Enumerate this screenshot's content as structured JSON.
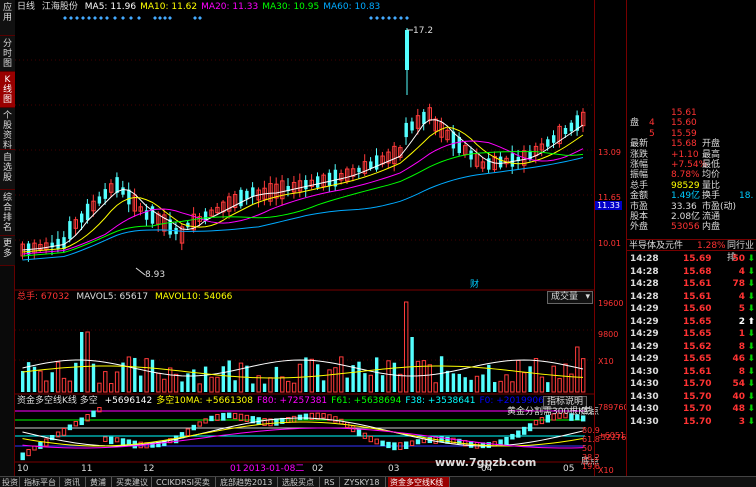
{
  "header": {
    "period": "日线",
    "stock_name": "江海股份",
    "ma": [
      {
        "label": "MA5: 11.96",
        "color": "#ffffff"
      },
      {
        "label": "MA10: 11.62",
        "color": "#ffff00"
      },
      {
        "label": "MA20: 11.33",
        "color": "#ff00ff"
      },
      {
        "label": "MA30: 10.95",
        "color": "#00ff00"
      },
      {
        "label": "MA60: 10.83",
        "color": "#00aaff"
      }
    ]
  },
  "left_tabs": [
    {
      "label": "应用",
      "active": false
    },
    {
      "label": "分时图",
      "active": false
    },
    {
      "label": "K线图",
      "active": true
    },
    {
      "label": "个股资料",
      "active": false
    },
    {
      "label": "自选股",
      "active": false
    },
    {
      "label": "综合排名",
      "active": false
    },
    {
      "label": "更多",
      "active": false
    }
  ],
  "price_panel": {
    "axis_labels": [
      "13.09",
      "11.65",
      "11.33",
      "10.01"
    ],
    "high_label": "17.2",
    "low_label": "8.93",
    "marker": "财",
    "price_tag": "11.33"
  },
  "volume_panel": {
    "total_label": "总手: 67032",
    "vol5_label": "MAVOL5: 65617",
    "vol10_label": "MAVOL10: 54066",
    "dropdown": "成交量",
    "axis_labels": [
      "19600",
      "9800",
      "X10"
    ]
  },
  "indicator_panel": {
    "title": "资金多空线K线 多空",
    "values": [
      {
        "label": "+5696142",
        "color": "#ffffff"
      },
      {
        "label": "多空10MA: +5661308",
        "color": "#ffff00"
      },
      {
        "label": "F80: +7257381",
        "color": "#ff00ff"
      },
      {
        "label": "F61: +5638694",
        "color": "#00ff00"
      },
      {
        "label": "F38: +3538641",
        "color": "#00ffff"
      },
      {
        "label": "F0: +2019906",
        "color": "#0000ff"
      }
    ],
    "indicator_button": "指标说明",
    "note": "黄金分割需300根K线",
    "note2": "底点",
    "note3": "底点",
    "axis_labels": [
      "7897607",
      "+605113",
      "-3227620",
      "X10"
    ],
    "right_labels": [
      "80.9",
      "61.8",
      "50",
      "38.2",
      "19.6"
    ]
  },
  "date_axis": [
    "10",
    "11",
    "12",
    "01",
    "2013-01-08二",
    "02",
    "03",
    "04",
    "05"
  ],
  "quote": {
    "top_rows": [
      {
        "l": "",
        "v": "15.61",
        "v2": "",
        "c": "#f33"
      },
      {
        "l": "盘",
        "v": "4",
        "v2": "15.60",
        "c": "#f33"
      },
      {
        "l": "",
        "v": "5",
        "v2": "15.59",
        "c": "#f33"
      },
      {
        "l": "最新",
        "v": "15.68",
        "l2": "开盘",
        "v2": "",
        "c": "#f33"
      },
      {
        "l": "涨跌",
        "v": "+1.10",
        "l2": "最高",
        "v2": "",
        "c": "#f33"
      },
      {
        "l": "涨幅",
        "v": "+7.54%",
        "l2": "最低",
        "v2": "",
        "c": "#f33"
      },
      {
        "l": "振幅",
        "v": "8.78%",
        "l2": "均价",
        "v2": "",
        "c": "#f33"
      },
      {
        "l": "总手",
        "v": "98529",
        "l2": "量比",
        "v2": "",
        "c": "#ff0"
      },
      {
        "l": "金额",
        "v": "1.49亿",
        "l2": "换手",
        "v2": "18.",
        "c": "#0cf"
      },
      {
        "l": "市盈",
        "v": "33.36",
        "l2": "市盈(动)",
        "v2": "",
        "c": "#ddd"
      },
      {
        "l": "股本",
        "v": "2.08亿",
        "l2": "流通",
        "v2": "",
        "c": "#ddd"
      },
      {
        "l": "外盘",
        "v": "53056",
        "l2": "内盘",
        "v2": "",
        "c": "#f33"
      }
    ],
    "sector": "半导体及元件",
    "sector_pct": "1.28%",
    "sector_rank": "同行业排",
    "ticks": [
      {
        "t": "14:28",
        "p": "15.69",
        "v": "50",
        "d": "down"
      },
      {
        "t": "14:28",
        "p": "15.68",
        "v": "4",
        "d": "down"
      },
      {
        "t": "14:28",
        "p": "15.61",
        "v": "78",
        "d": "down"
      },
      {
        "t": "14:28",
        "p": "15.61",
        "v": "4",
        "d": "down"
      },
      {
        "t": "14:29",
        "p": "15.60",
        "v": "5",
        "d": "down"
      },
      {
        "t": "14:29",
        "p": "15.65",
        "v": "2",
        "d": "up"
      },
      {
        "t": "14:29",
        "p": "15.65",
        "v": "1",
        "d": "down"
      },
      {
        "t": "14:29",
        "p": "15.62",
        "v": "8",
        "d": "down"
      },
      {
        "t": "14:29",
        "p": "15.65",
        "v": "46",
        "d": "down"
      },
      {
        "t": "14:30",
        "p": "15.61",
        "v": "8",
        "d": "down"
      },
      {
        "t": "14:30",
        "p": "15.70",
        "v": "54",
        "d": "down"
      },
      {
        "t": "14:30",
        "p": "15.70",
        "v": "40",
        "d": "down"
      },
      {
        "t": "14:30",
        "p": "15.70",
        "v": "48",
        "d": "down"
      },
      {
        "t": "14:30",
        "p": "15.70",
        "v": "3",
        "d": "down"
      }
    ]
  },
  "bottom_tabs": [
    {
      "label": "投资",
      "active": false
    },
    {
      "label": "指标平台",
      "active": false
    },
    {
      "label": "资讯",
      "active": false
    },
    {
      "label": "黄浦",
      "active": false
    },
    {
      "label": "买卖建议",
      "active": false
    },
    {
      "label": "CCIKDRSI买卖",
      "active": false
    },
    {
      "label": "底部趋势2013",
      "active": false
    },
    {
      "label": "选股买点",
      "active": false
    },
    {
      "label": "RS",
      "active": false
    },
    {
      "label": "ZYSKY18",
      "active": false
    },
    {
      "label": "资金多空线K线",
      "active": true
    }
  ],
  "watermark": "www.7gpzb.com"
}
